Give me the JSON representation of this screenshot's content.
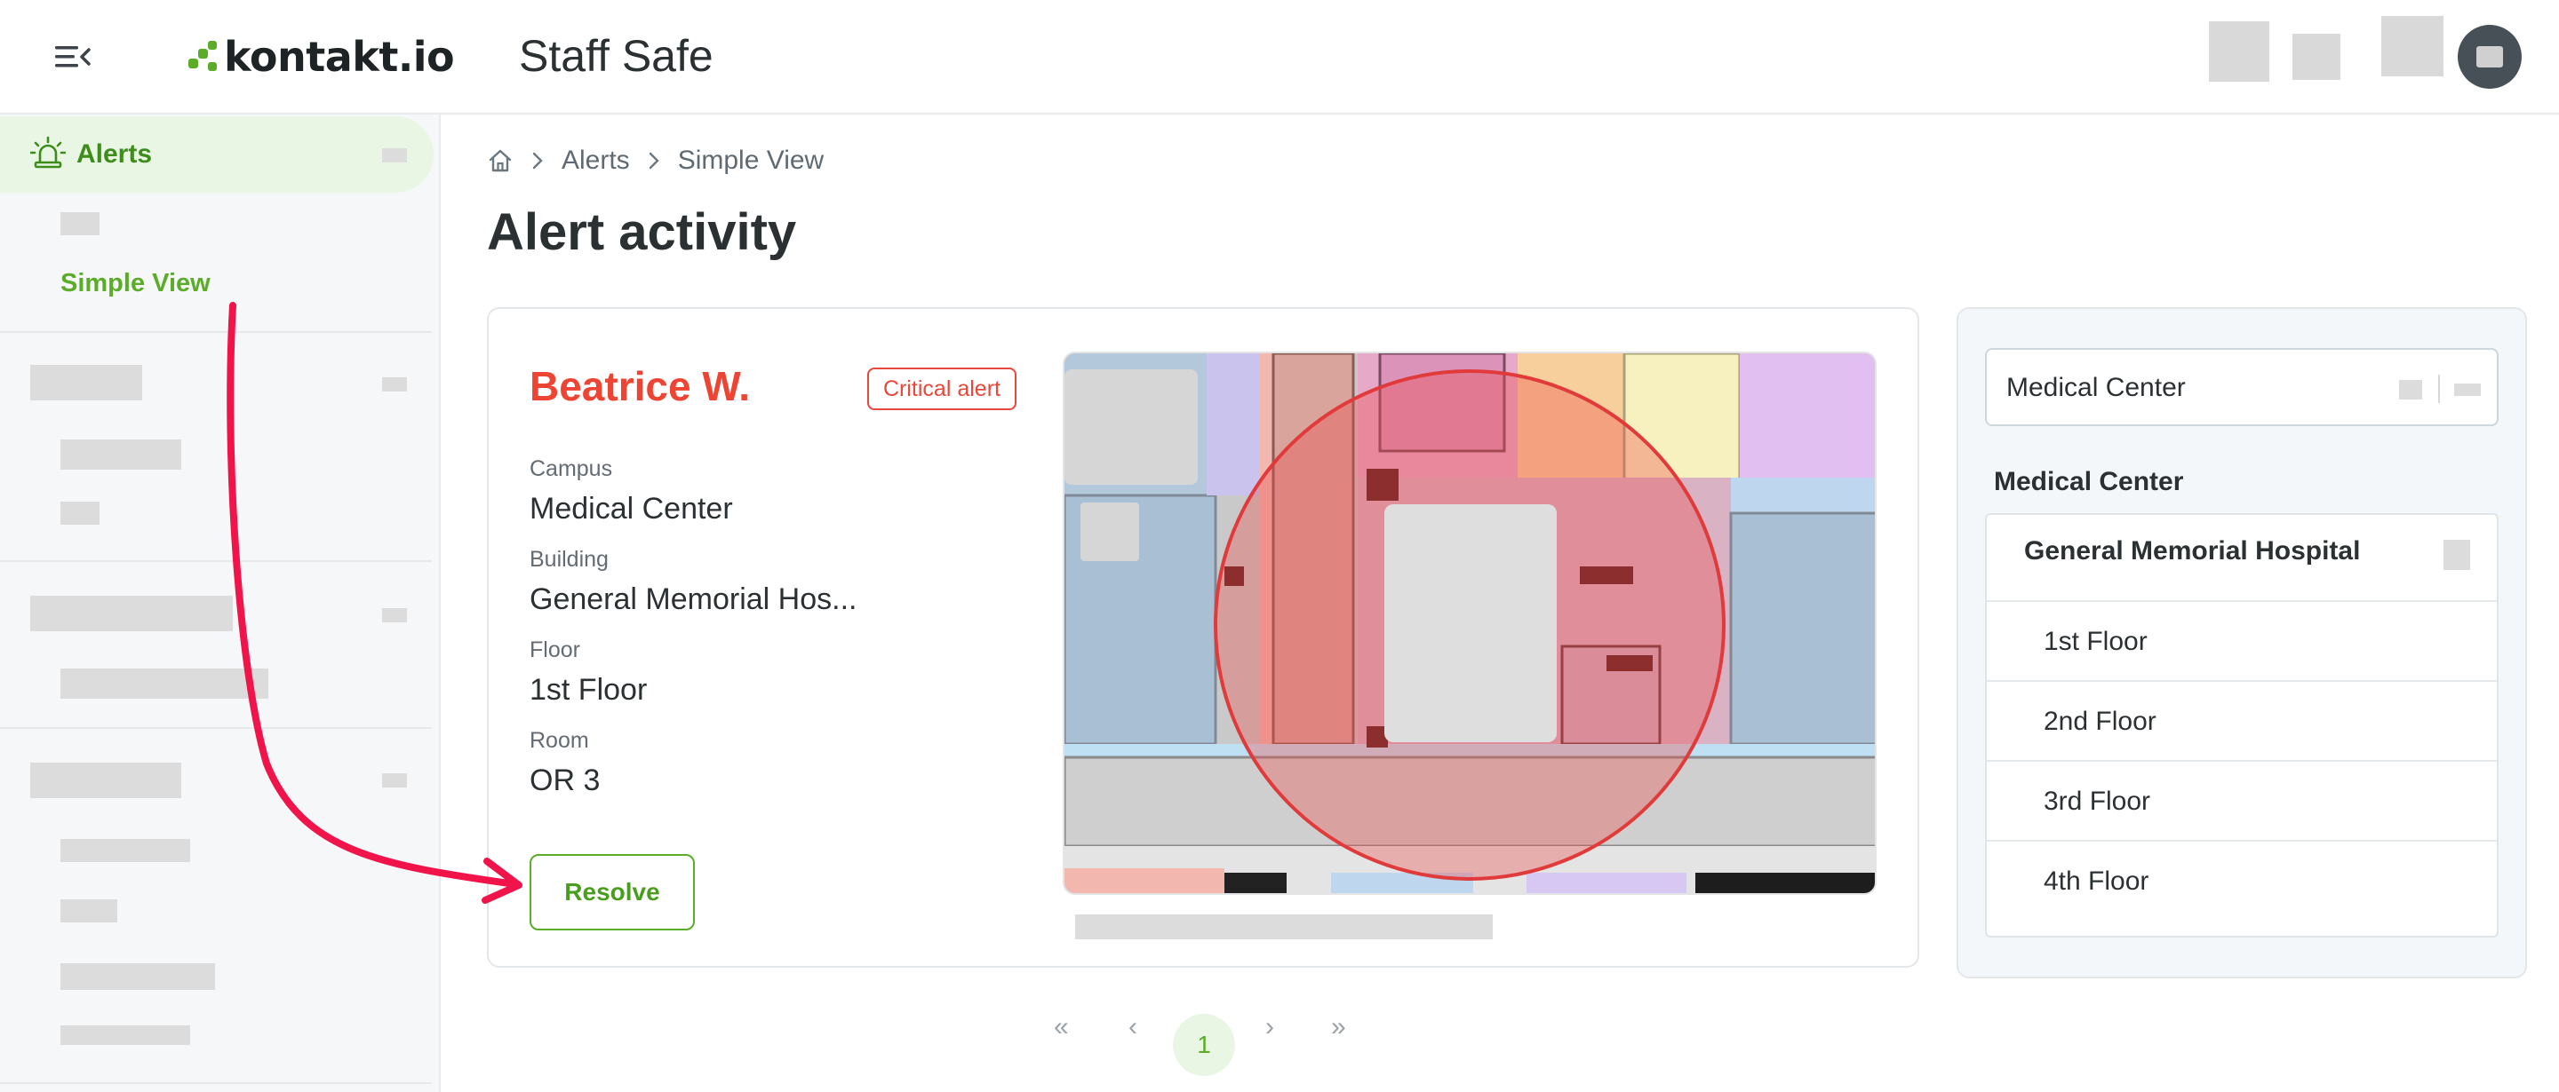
{
  "header": {
    "logo_text": "kontakt.io",
    "app_name": "Staff Safe"
  },
  "sidebar": {
    "active_item": "Alerts",
    "active_sub_item": "Simple View"
  },
  "breadcrumb": [
    "Alerts",
    "Simple View"
  ],
  "page": {
    "title": "Alert activity"
  },
  "alert": {
    "person": "Beatrice W.",
    "badge": "Critical alert",
    "fields": [
      {
        "label": "Campus",
        "value": "Medical Center"
      },
      {
        "label": "Building",
        "value": "General Memorial Hos..."
      },
      {
        "label": "Floor",
        "value": "1st Floor"
      },
      {
        "label": "Room",
        "value": "OR 3"
      }
    ],
    "resolve_label": "Resolve"
  },
  "location_panel": {
    "selected_campus": "Medical Center",
    "heading": "Medical Center",
    "building": "General Memorial Hospital",
    "floors": [
      "1st Floor",
      "2nd Floor",
      "3rd Floor",
      "4th Floor"
    ]
  },
  "pagination": {
    "first": "«",
    "prev": "‹",
    "current": "1",
    "next": "›",
    "last": "»"
  },
  "colors": {
    "brand_green": "#5aac29",
    "alert_red": "#ee4433",
    "annotation_arrow": "#f0144a"
  }
}
